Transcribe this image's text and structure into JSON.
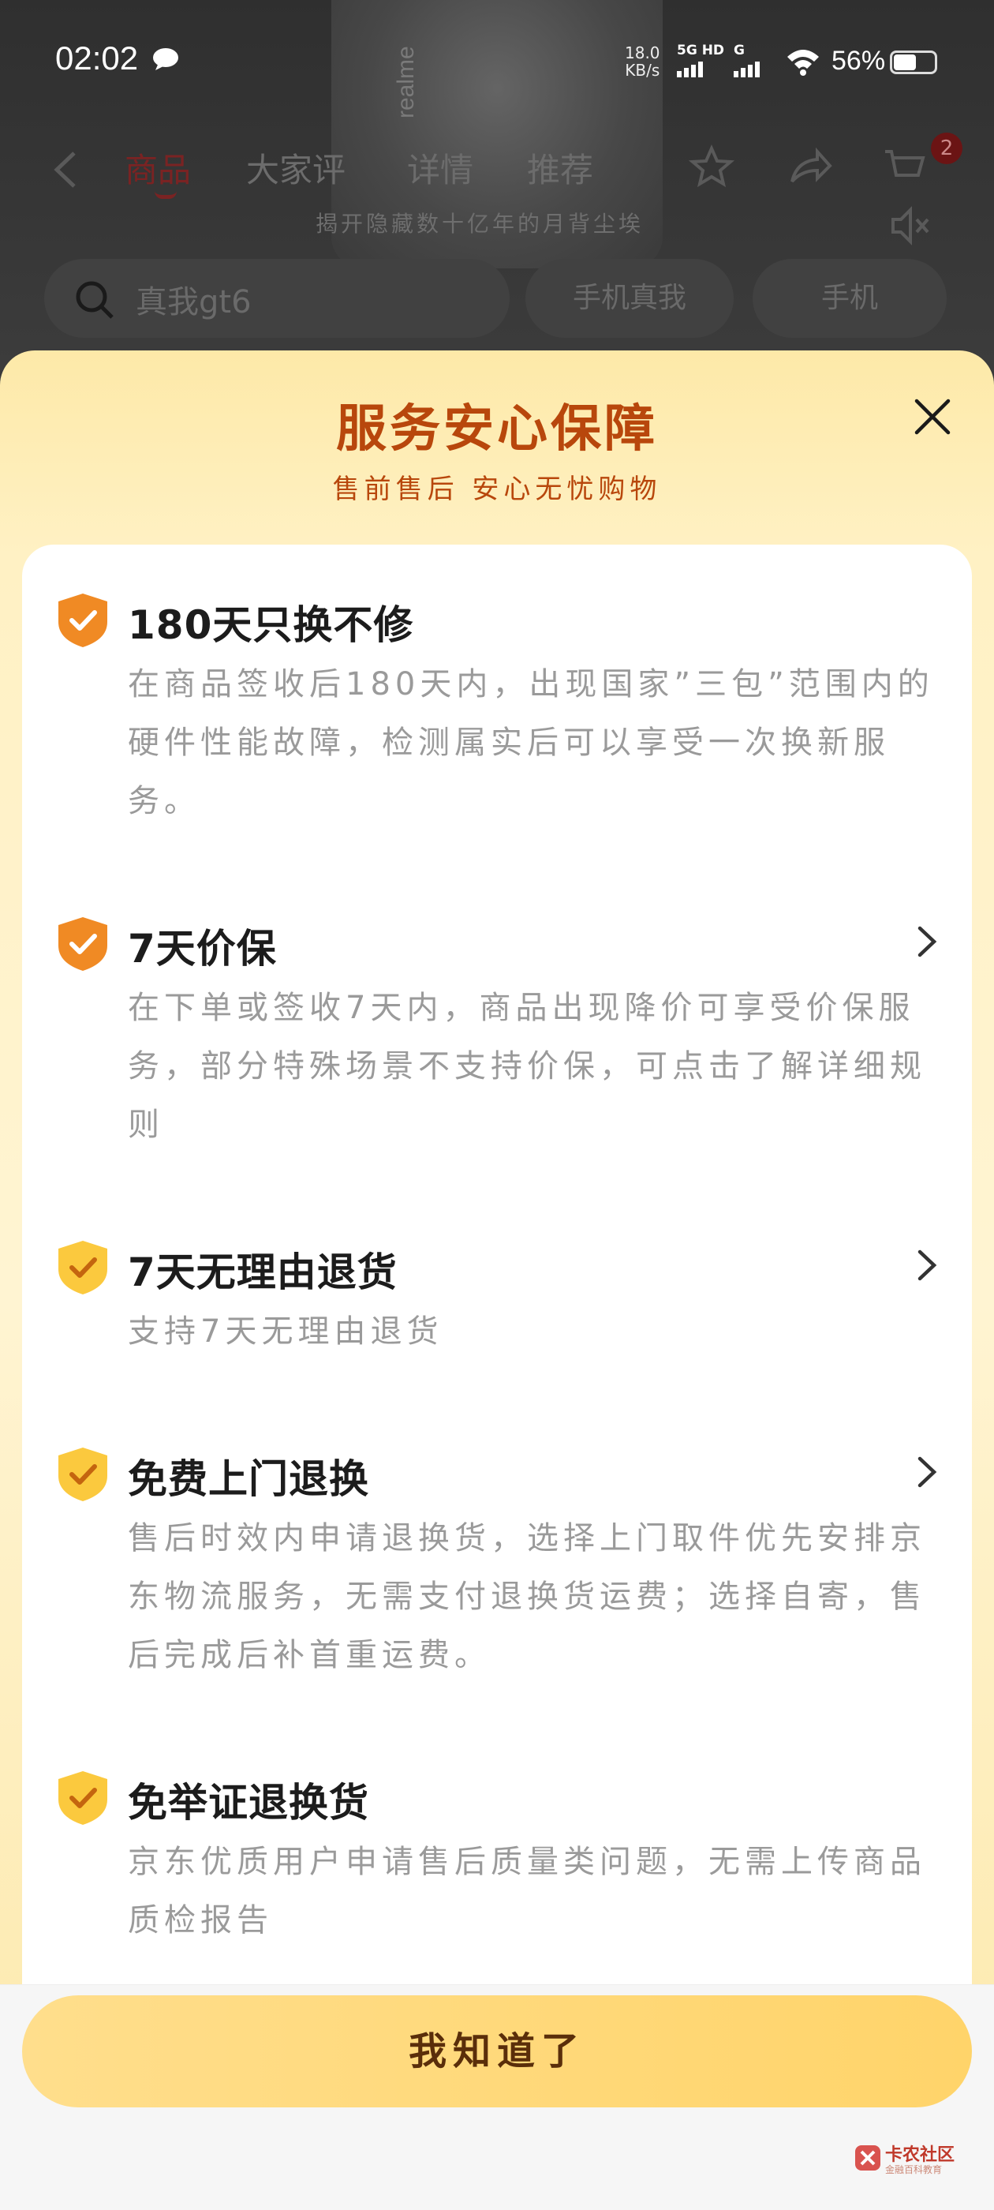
{
  "status_bar": {
    "time": "02:02",
    "net_speed_value": "18.0",
    "net_speed_unit": "KB/s",
    "sim1_label": "5G HD",
    "sim2_label": "G",
    "battery_percent": "56%",
    "battery_level": 0.56
  },
  "background_page": {
    "brand_text": "realme",
    "tabs": [
      {
        "label": "商品",
        "active": true
      },
      {
        "label": "大家评",
        "active": false
      },
      {
        "label": "详情",
        "active": false
      },
      {
        "label": "推荐",
        "active": false
      }
    ],
    "cart_badge": "2",
    "video_subtitle": "揭开隐藏数十亿年的月背尘埃",
    "search_text": "真我gt6",
    "chips": [
      "手机真我",
      "手机"
    ]
  },
  "sheet": {
    "title": "服务安心保障",
    "subtitle": "售前售后 安心无忧购物",
    "items": [
      {
        "title": "180天只换不修",
        "desc": "在商品签收后180天内，出现国家”三包”范围内的硬件性能故障，检测属实后可以享受一次换新服务。",
        "icon": "shield-check-orange-icon",
        "has_chevron": false
      },
      {
        "title": "7天价保",
        "desc": "在下单或签收7天内，商品出现降价可享受价保服务，部分特殊场景不支持价保，可点击了解详细规则",
        "icon": "shield-check-orange-icon",
        "has_chevron": true
      },
      {
        "title": "7天无理由退货",
        "desc": "支持7天无理由退货",
        "icon": "shield-check-yellow-icon",
        "has_chevron": true
      },
      {
        "title": "免费上门退换",
        "desc": "售后时效内申请退换货，选择上门取件优先安排京东物流服务，无需支付退换货运费；选择自寄，售后完成后补首重运费。",
        "icon": "shield-check-yellow-icon",
        "has_chevron": true
      },
      {
        "title": "免举证退换货",
        "desc": "京东优质用户申请售后质量类问题，无需上传商品质检报告",
        "icon": "shield-check-yellow-icon",
        "has_chevron": false
      }
    ],
    "confirm_button": "我知道了"
  },
  "watermark": {
    "name": "卡农社区",
    "slogan": "金融百科教育"
  },
  "colors": {
    "title_orange": "#b8470c",
    "shield_orange": "#f08a24",
    "shield_yellow": "#fbc93e",
    "button_yellow": "#ffd46a"
  }
}
